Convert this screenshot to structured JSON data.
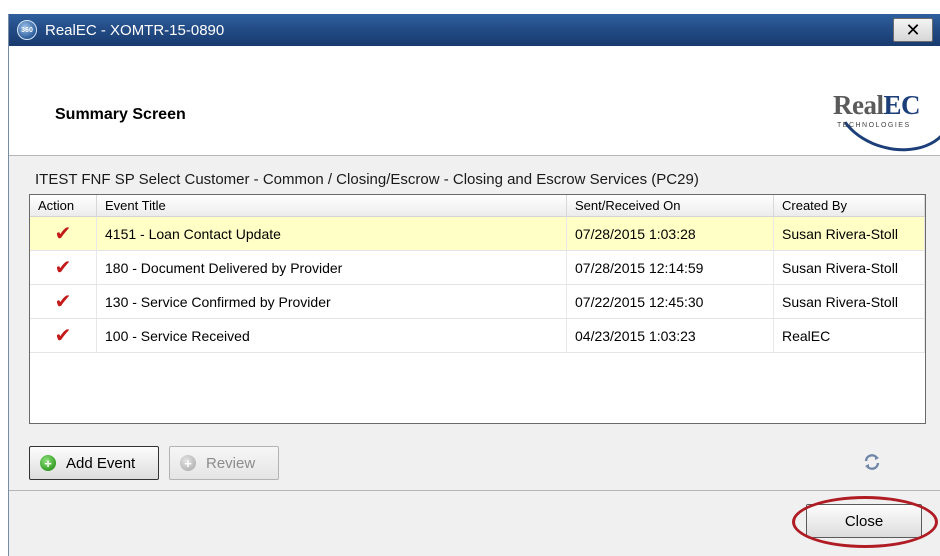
{
  "window": {
    "badge": "360",
    "title": "RealEC - XOMTR-15-0890",
    "close_glyph": "✕"
  },
  "header": {
    "screen_title": "Summary Screen",
    "logo_main": "Real",
    "logo_accent": "EC",
    "logo_sub": "TECHNOLOGIES"
  },
  "customer_line": "ITEST FNF SP Select Customer - Common / Closing/Escrow - Closing and Escrow Services (PC29)",
  "grid": {
    "columns": [
      "Action",
      "Event Title",
      "Sent/Received On",
      "Created By"
    ],
    "rows": [
      {
        "action_icon": "✔",
        "event": "4151 - Loan Contact Update",
        "date": "07/28/2015 1:03:28",
        "created_by": "Susan Rivera-Stoll",
        "selected": true
      },
      {
        "action_icon": "✔",
        "event": "180 - Document Delivered by Provider",
        "date": "07/28/2015 12:14:59",
        "created_by": "Susan Rivera-Stoll",
        "selected": false
      },
      {
        "action_icon": "✔",
        "event": "130 - Service Confirmed by Provider",
        "date": "07/22/2015 12:45:30",
        "created_by": "Susan Rivera-Stoll",
        "selected": false
      },
      {
        "action_icon": "✔",
        "event": "100 - Service Received",
        "date": "04/23/2015 1:03:23",
        "created_by": "RealEC",
        "selected": false
      }
    ]
  },
  "buttons": {
    "add_event": "Add Event",
    "review": "Review",
    "close": "Close",
    "plus_glyph": "+"
  },
  "icons": {
    "refresh": "refresh-icon",
    "check": "check-icon",
    "accent_color": "#c41a1a",
    "title_bar_color": "#234c86"
  }
}
